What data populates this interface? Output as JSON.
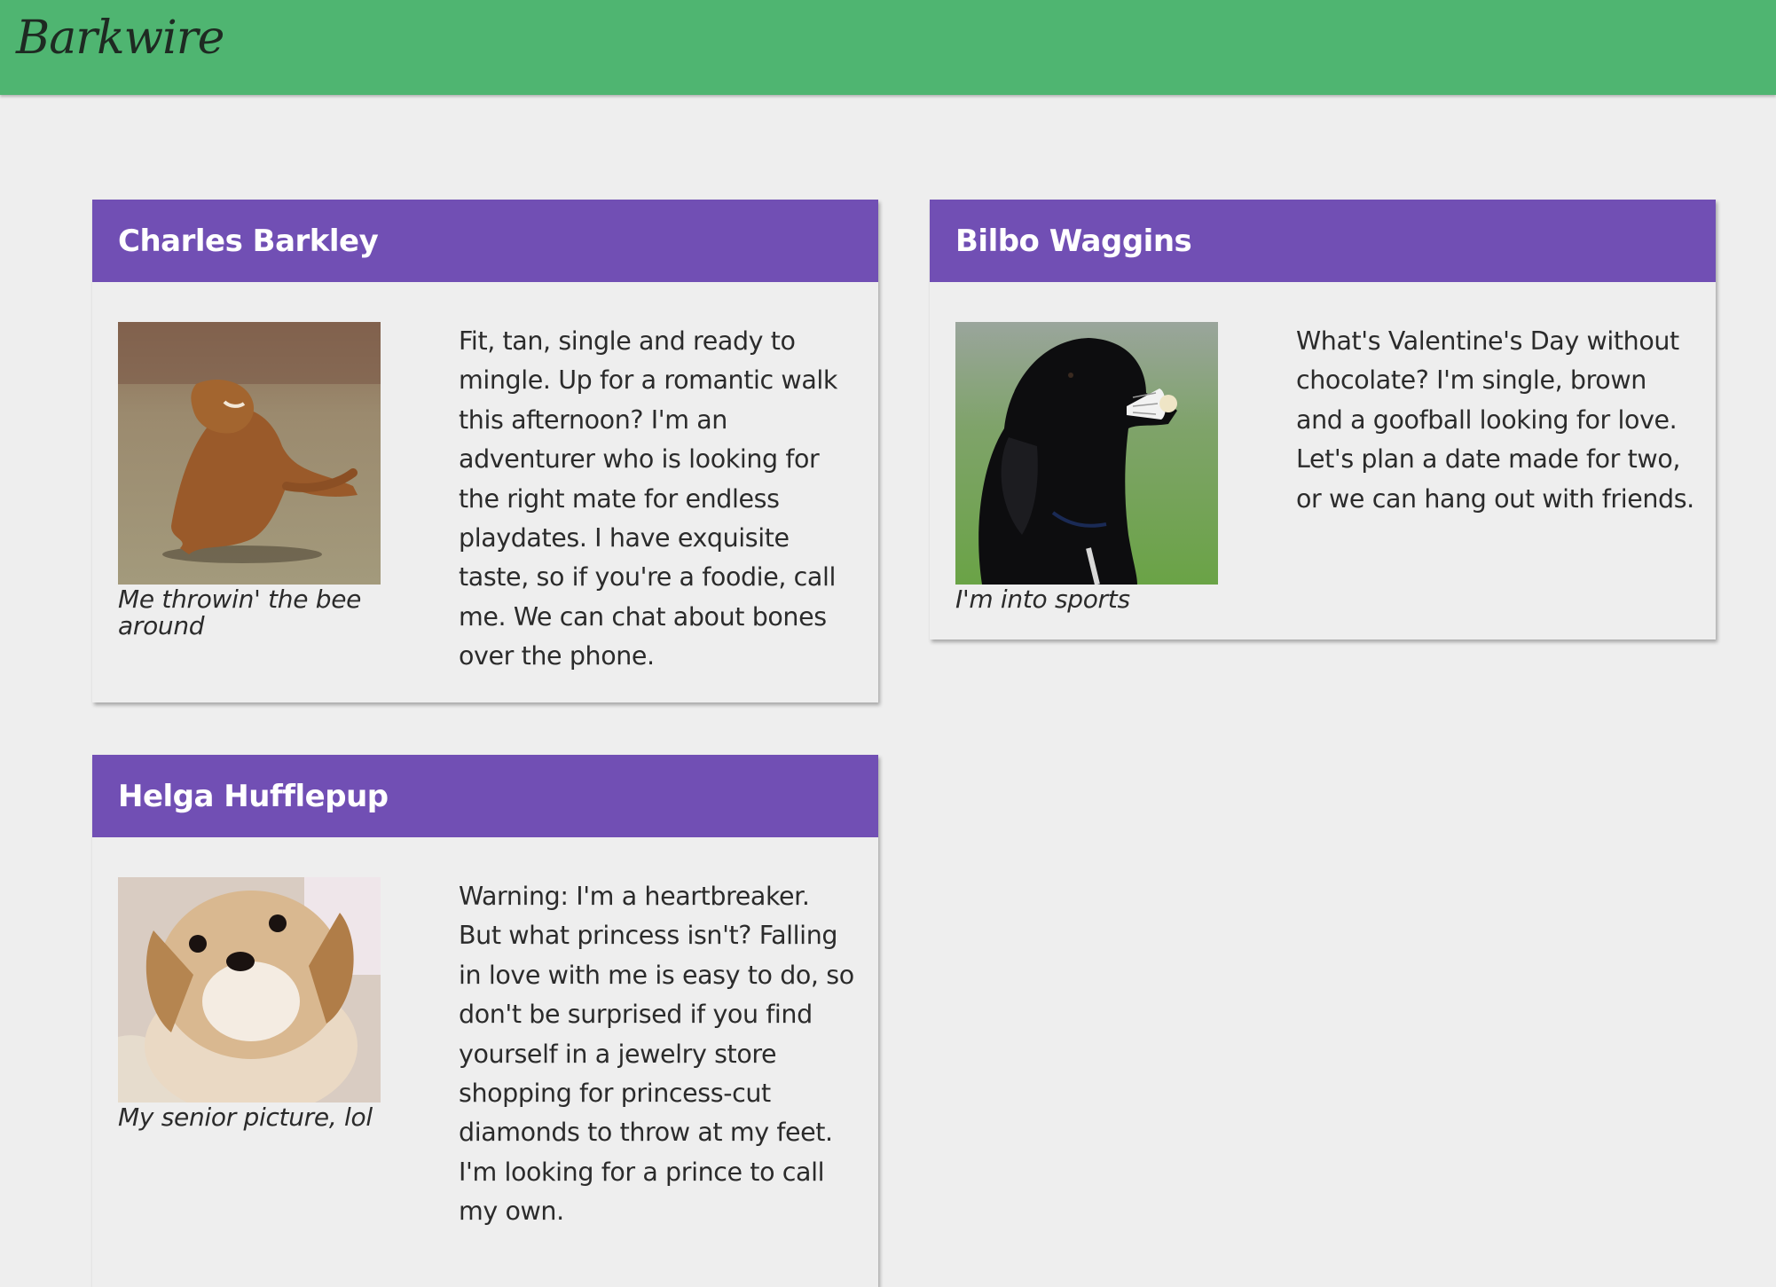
{
  "app": {
    "brand": "Barkwire"
  },
  "profiles": [
    {
      "name": "Charles Barkley",
      "caption": "Me throwin' the bee around",
      "bio": "Fit, tan, single and ready to mingle. Up for a romantic walk this afternoon? I'm an adventurer who is looking for the right mate for endless playdates. I have exquisite taste, so if you're a foodie, call me. We can chat about bones over the phone.",
      "photo_icon": "dog-photo-golden-retriever-jumping"
    },
    {
      "name": "Bilbo Waggins",
      "caption": "I'm into sports",
      "bio": "What's Valentine's Day without chocolate? I'm single, brown and a goofball looking for love. Let's plan a date made for two, or we can hang out with friends.",
      "photo_icon": "dog-photo-black-dog-with-shuttlecock"
    },
    {
      "name": "Helga Hufflepup",
      "caption": "My senior picture, lol",
      "bio": "Warning: I'm a heartbreaker. But what princess isn't? Falling in love with me is easy to do, so don't be surprised if you find yourself in a jewelry store shopping for princess-cut diamonds to throw at my feet. I'm looking for a prince to call my own.",
      "photo_icon": "dog-photo-fluffy-puppy"
    }
  ],
  "colors": {
    "header": "#4fb571",
    "card_header": "#714fb4",
    "background": "#eeeeee"
  }
}
